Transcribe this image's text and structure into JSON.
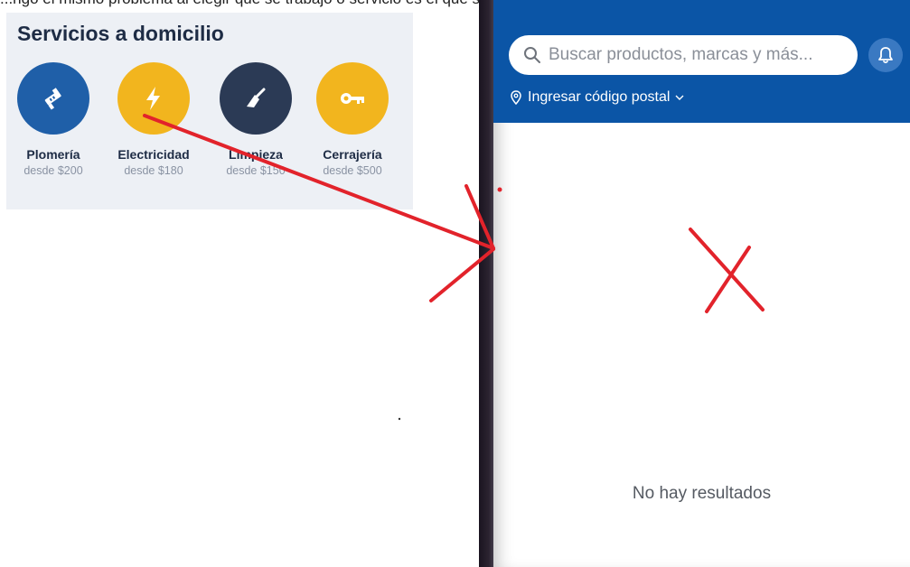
{
  "caption": {
    "text": "...ngo el mismo problema al elegir que se trabajo o servicio es el que se muestra que hay"
  },
  "services_panel": {
    "title": "Servicios a domicilio",
    "items": [
      {
        "name": "Plomería",
        "price": "desde $200",
        "color": "#1f5fa8",
        "icon": "plumbing-icon"
      },
      {
        "name": "Electricidad",
        "price": "desde $180",
        "color": "#f2b51e",
        "icon": "lightning-icon"
      },
      {
        "name": "Limpieza",
        "price": "desde $150",
        "color": "#2b3a55",
        "icon": "broom-icon"
      },
      {
        "name": "Cerrajería",
        "price": "desde $500",
        "color": "#f2b51e",
        "icon": "key-icon"
      }
    ]
  },
  "app": {
    "header_color": "#0b55a6",
    "search": {
      "placeholder": "Buscar productos, marcas y más..."
    },
    "postal_label": "Ingresar código postal",
    "empty_message": "No hay resultados"
  },
  "annotation": {
    "color": "#e2232b"
  }
}
